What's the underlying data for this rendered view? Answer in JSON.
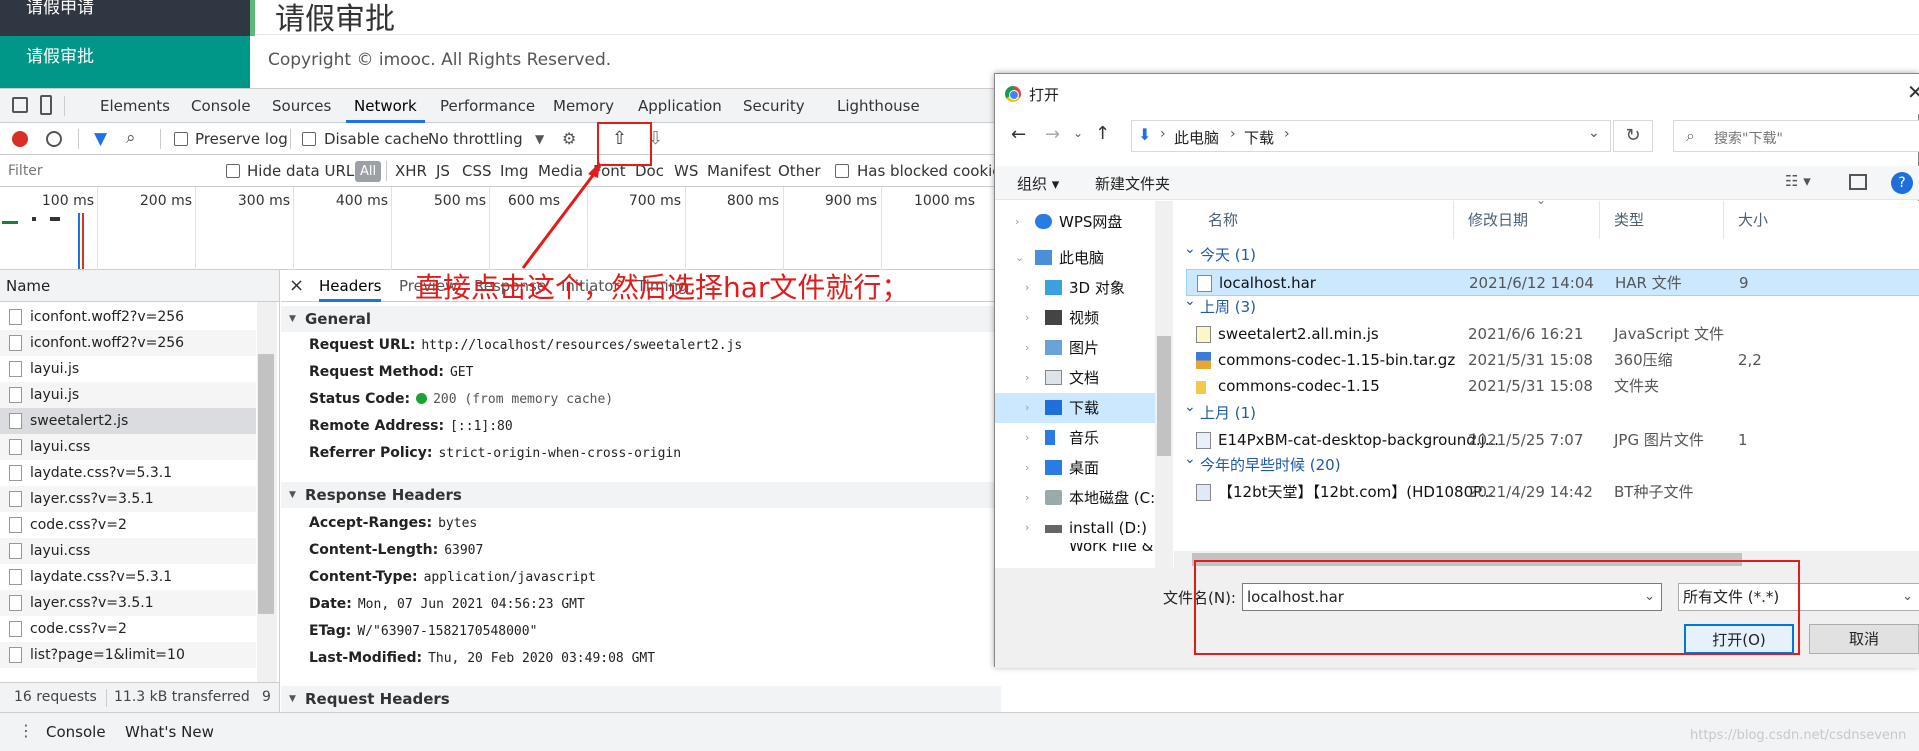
{
  "app": {
    "sidebar_items": [
      "请假申请",
      "请假审批"
    ],
    "page_title": "请假审批",
    "copyright": "Copyright © imooc. All Rights Reserved."
  },
  "devtools": {
    "tabs": [
      "Elements",
      "Console",
      "Sources",
      "Network",
      "Performance",
      "Memory",
      "Application",
      "Security",
      "Lighthouse"
    ],
    "active_tab": "Network",
    "toolbar": {
      "preserve_log": "Preserve log",
      "disable_cache": "Disable cache",
      "throttling": "No throttling"
    },
    "filter": {
      "placeholder": "Filter",
      "hide_data_urls": "Hide data URLs",
      "all": "All",
      "types": [
        "XHR",
        "JS",
        "CSS",
        "Img",
        "Media",
        "Font",
        "Doc",
        "WS",
        "Manifest",
        "Other"
      ],
      "blocked": "Has blocked cookies"
    },
    "timeline_ticks": [
      "100 ms",
      "200 ms",
      "300 ms",
      "400 ms",
      "500 ms",
      "600 ms",
      "700 ms",
      "800 ms",
      "900 ms",
      "1000 ms"
    ],
    "request_list": {
      "header": "Name",
      "rows": [
        "iconfont.woff2?v=256",
        "iconfont.woff2?v=256",
        "layui.js",
        "layui.js",
        "sweetalert2.js",
        "layui.css",
        "laydate.css?v=5.3.1",
        "layer.css?v=3.5.1",
        "code.css?v=2",
        "layui.css",
        "laydate.css?v=5.3.1",
        "layer.css?v=3.5.1",
        "code.css?v=2",
        "list?page=1&limit=10"
      ],
      "selected": "sweetalert2.js",
      "requests": "16 requests",
      "transferred": "11.3 kB transferred",
      "more": "9"
    },
    "details": {
      "close": "×",
      "tabs": [
        "Headers",
        "Preview",
        "Response",
        "Initiator",
        "Timing"
      ],
      "active_tab": "Headers",
      "general_title": "General",
      "general": [
        {
          "k": "Request URL:",
          "v": "http://localhost/resources/sweetalert2.js"
        },
        {
          "k": "Request Method:",
          "v": "GET"
        },
        {
          "k": "Status Code:",
          "v": "200  (from memory cache)"
        },
        {
          "k": "Remote Address:",
          "v": "[::1]:80"
        },
        {
          "k": "Referrer Policy:",
          "v": "strict-origin-when-cross-origin"
        }
      ],
      "response_title": "Response Headers",
      "response": [
        {
          "k": "Accept-Ranges:",
          "v": "bytes"
        },
        {
          "k": "Content-Length:",
          "v": "63907"
        },
        {
          "k": "Content-Type:",
          "v": "application/javascript"
        },
        {
          "k": "Date:",
          "v": "Mon, 07 Jun 2021 04:56:23 GMT"
        },
        {
          "k": "ETag:",
          "v": "W/\"63907-1582170548000\""
        },
        {
          "k": "Last-Modified:",
          "v": "Thu, 20 Feb 2020 03:49:08 GMT"
        }
      ],
      "request_title": "Request Headers"
    },
    "drawer": [
      "Console",
      "What's New"
    ]
  },
  "annotation": "直接点击这个，然后选择har文件就行；",
  "dialog": {
    "title": "打开",
    "breadcrumb": [
      "此电脑",
      "下载"
    ],
    "search_placeholder": "搜索\"下载\"",
    "organize": "组织 ▾",
    "new_folder": "新建文件夹",
    "nav": [
      "WPS网盘",
      "此电脑",
      "3D 对象",
      "视频",
      "图片",
      "文档",
      "下载",
      "音乐",
      "桌面",
      "本地磁盘 (C:)",
      "install (D:)",
      "Work File & W..."
    ],
    "nav_selected": "下载",
    "columns": [
      "名称",
      "修改日期",
      "类型",
      "大小"
    ],
    "groups": [
      {
        "label": "今天 (1)",
        "files": [
          {
            "name": "localhost.har",
            "date": "2021/6/12 14:04",
            "type": "HAR 文件",
            "size": "9"
          }
        ]
      },
      {
        "label": "上周 (3)",
        "files": [
          {
            "name": "sweetalert2.all.min.js",
            "date": "2021/6/6 16:21",
            "type": "JavaScript 文件",
            "size": ""
          },
          {
            "name": "commons-codec-1.15-bin.tar.gz",
            "date": "2021/5/31 15:08",
            "type": "360压缩",
            "size": "2,2"
          },
          {
            "name": "commons-codec-1.15",
            "date": "2021/5/31 15:08",
            "type": "文件夹",
            "size": ""
          }
        ]
      },
      {
        "label": "上月 (1)",
        "files": [
          {
            "name": "E14PxBM-cat-desktop-background.j...",
            "date": "2021/5/25 7:07",
            "type": "JPG 图片文件",
            "size": "1"
          }
        ]
      },
      {
        "label": "今年的早些时候 (20)",
        "files": [
          {
            "name": "【12bt天堂】【12bt.com】(HD1080P...",
            "date": "2021/4/29 14:42",
            "type": "BT种子文件",
            "size": ""
          }
        ]
      }
    ],
    "selected_file": "localhost.har",
    "filename_label": "文件名(N):",
    "filename_value": "localhost.har",
    "filetype": "所有文件 (*.*)",
    "open": "打开(O)",
    "cancel": "取消"
  },
  "watermark": "https://blog.csdn.net/csdnsevenn",
  "colors": {
    "accent_teal": "#009688",
    "annotation_red": "#e21b1b",
    "devtools_blue": "#1a73e8"
  }
}
